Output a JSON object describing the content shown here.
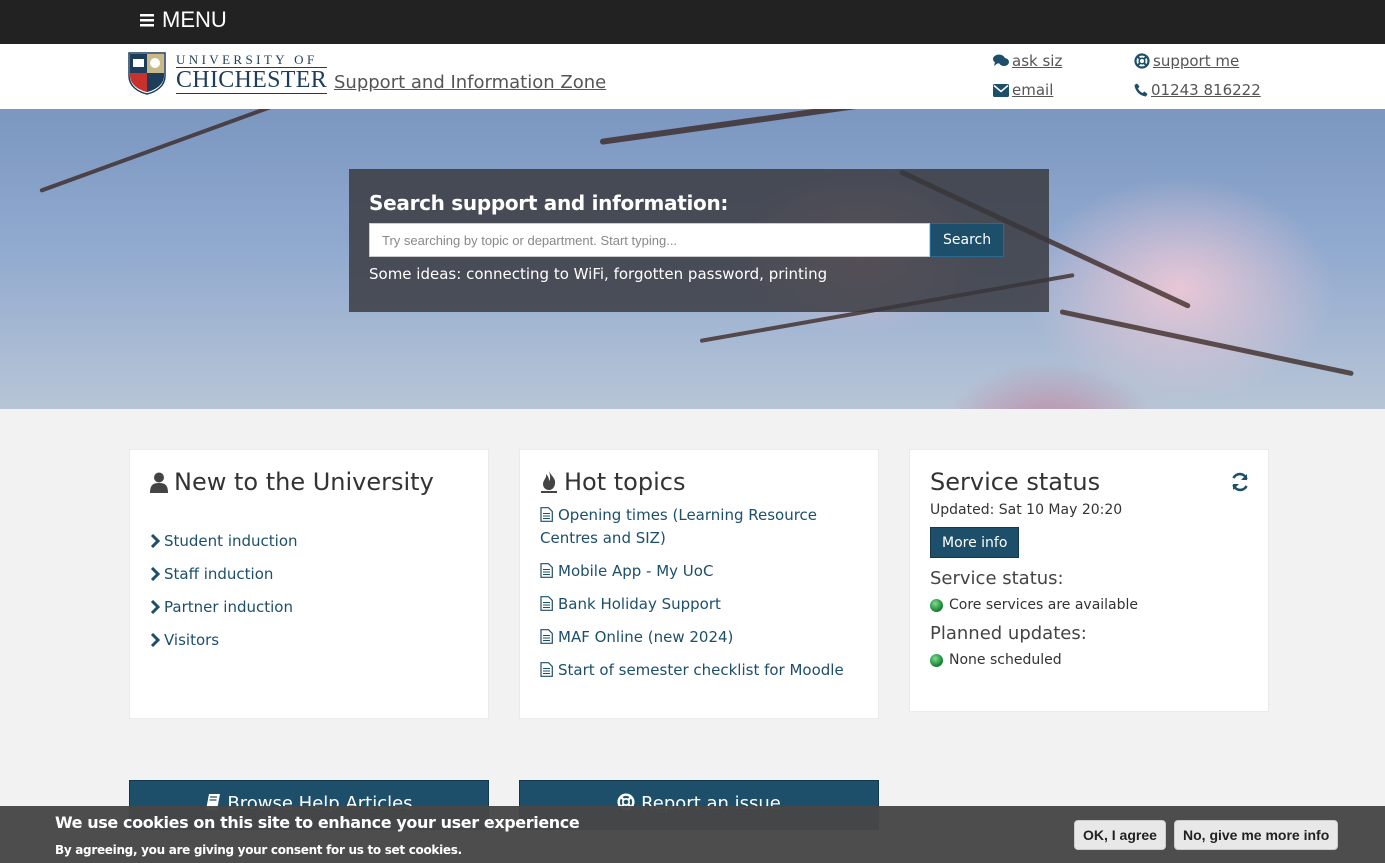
{
  "topbar": {
    "menu_label": "MENU"
  },
  "header": {
    "logo_top": "UNIVERSITY OF",
    "logo_bottom": "CHICHESTER",
    "site_title": "Support and Information Zone",
    "links": {
      "ask": "ask siz",
      "support": "support me",
      "email": "email",
      "phone": "01243 816222"
    }
  },
  "search": {
    "title": "Search support and information:",
    "placeholder": "Try searching by topic or department. Start typing...",
    "button": "Search",
    "ideas_label": "Some ideas:",
    "ideas": [
      "connecting to WiFi",
      "forgotten password",
      "printing"
    ]
  },
  "new_to_uni": {
    "title": "New to the University",
    "items": [
      "Student induction",
      "Staff induction",
      "Partner induction",
      "Visitors"
    ]
  },
  "hot_topics": {
    "title": "Hot topics",
    "items": [
      "Opening times (Learning Resource Centres and SIZ)",
      "Mobile App - My UoC",
      "Bank Holiday Support",
      "MAF Online (new 2024)",
      "Start of semester checklist for Moodle"
    ]
  },
  "service_status": {
    "title": "Service status",
    "updated": "Updated: Sat 10 May 20:20",
    "more_info": "More info",
    "status_heading": "Service status:",
    "status_text": "Core services are available",
    "planned_heading": "Planned updates:",
    "planned_text": "None scheduled",
    "status_color": "#1e8a3a"
  },
  "actions": {
    "browse": "Browse Help Articles",
    "report": "Report an issue"
  },
  "cookie": {
    "heading": "We use cookies on this site to enhance your user experience",
    "sub": "By agreeing, you are giving your consent for us to set cookies.",
    "agree": "OK, I agree",
    "more": "No, give me more info"
  },
  "colors": {
    "brand": "#1d4f6b",
    "topbar": "#222222"
  }
}
